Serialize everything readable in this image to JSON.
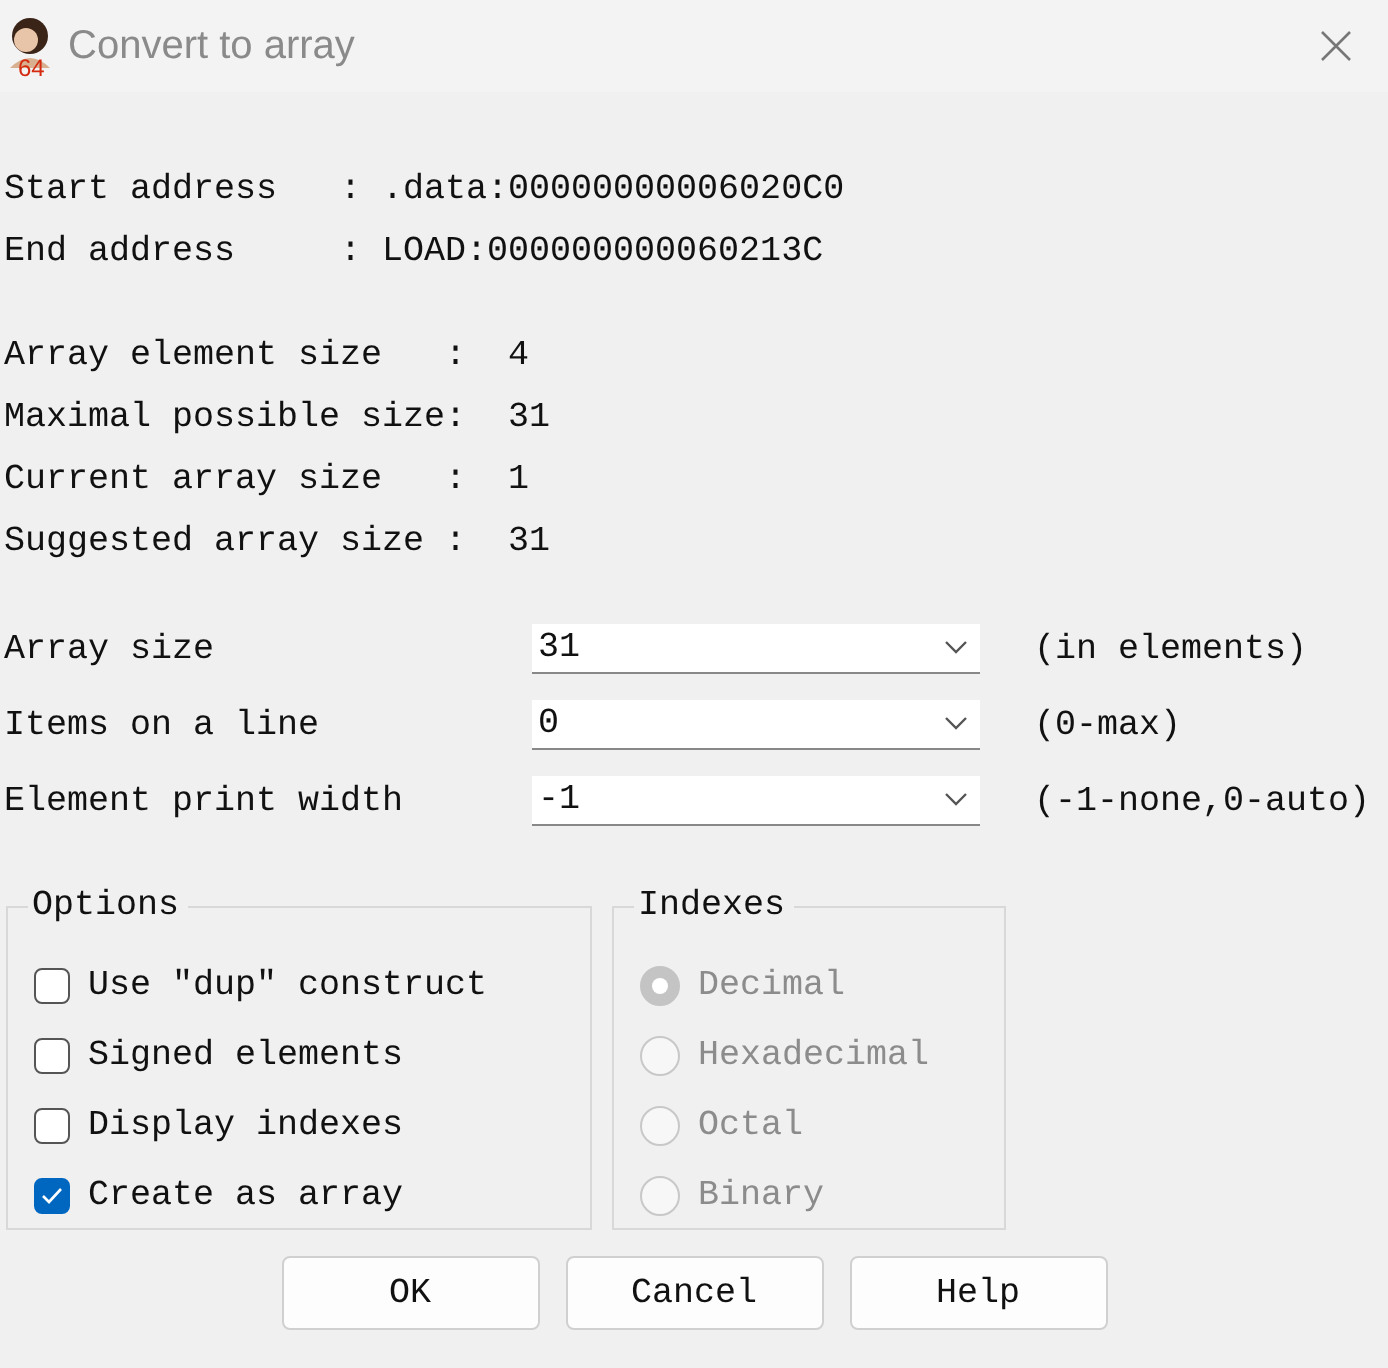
{
  "window": {
    "title": "Convert to array",
    "icon_badge": "64"
  },
  "address_lines": [
    "Start address   : .data:00000000006020C0",
    "End address     : LOAD:000000000060213C"
  ],
  "size_lines": [
    "Array element size   :  4",
    "Maximal possible size:  31",
    "Current array size   :  1",
    "Suggested array size :  31"
  ],
  "fields": [
    {
      "label": "Array size",
      "value": "31",
      "hint": "(in elements)"
    },
    {
      "label": "Items on a line",
      "value": "0",
      "hint": "(0-max)"
    },
    {
      "label": "Element print width",
      "value": "-1",
      "hint": "(-1-none,0-auto)"
    }
  ],
  "options": {
    "title": "Options",
    "items": [
      {
        "label": "Use \"dup\" construct",
        "checked": false
      },
      {
        "label": "Signed elements",
        "checked": false
      },
      {
        "label": "Display indexes",
        "checked": false
      },
      {
        "label": "Create as array",
        "checked": true
      }
    ]
  },
  "indexes": {
    "title": "Indexes",
    "disabled": true,
    "items": [
      {
        "label": "Decimal",
        "selected": true
      },
      {
        "label": "Hexadecimal",
        "selected": false
      },
      {
        "label": "Octal",
        "selected": false
      },
      {
        "label": "Binary",
        "selected": false
      }
    ]
  },
  "buttons": [
    "OK",
    "Cancel",
    "Help"
  ]
}
